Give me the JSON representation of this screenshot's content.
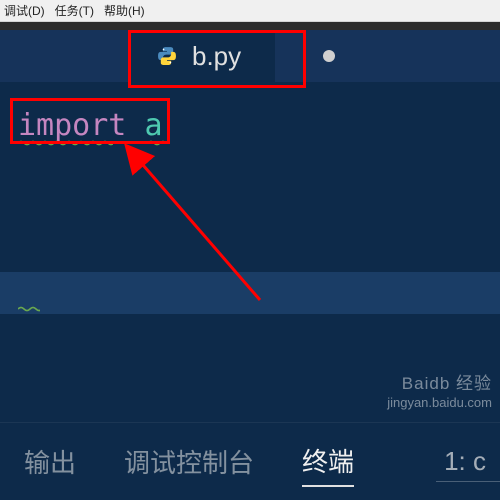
{
  "menu": {
    "debug": "调试(D)",
    "tasks": "任务(T)",
    "help": "帮助(H)"
  },
  "tab": {
    "filename": "b.py",
    "modified": true
  },
  "editor": {
    "keyword": "import",
    "module": "a"
  },
  "panel": {
    "output": "输出",
    "debug_console": "调试控制台",
    "terminal": "终端",
    "dropdown": "1: c"
  },
  "watermark": {
    "brand": "Baidb 经验",
    "url": "jingyan.baidu.com"
  }
}
